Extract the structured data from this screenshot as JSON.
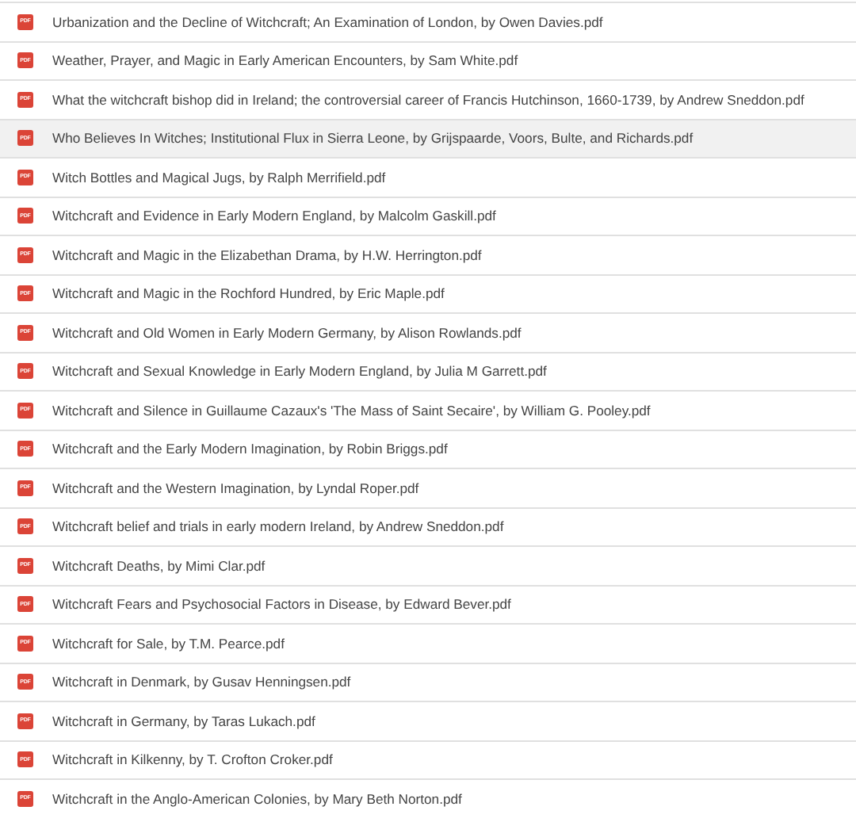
{
  "files": [
    {
      "name": "Urbanization and the Decline of Witchcraft; An Examination of London, by Owen Davies.pdf",
      "badge": "PDF",
      "selected": false
    },
    {
      "name": "Weather, Prayer, and Magic in Early American Encounters, by Sam White.pdf",
      "badge": "PDF",
      "selected": false
    },
    {
      "name": "What the witchcraft bishop did in Ireland; the controversial career of Francis Hutchinson, 1660-1739, by Andrew Sneddon.pdf",
      "badge": "PDF",
      "selected": false
    },
    {
      "name": "Who Believes In Witches; Institutional Flux in Sierra Leone, by Grijspaarde, Voors, Bulte, and Richards.pdf",
      "badge": "PDF",
      "selected": true
    },
    {
      "name": "Witch Bottles and Magical Jugs, by Ralph Merrifield.pdf",
      "badge": "PDF",
      "selected": false
    },
    {
      "name": "Witchcraft and Evidence in Early Modern England, by Malcolm Gaskill.pdf",
      "badge": "PDF",
      "selected": false
    },
    {
      "name": "Witchcraft and Magic in the Elizabethan Drama, by H.W. Herrington.pdf",
      "badge": "PDF",
      "selected": false
    },
    {
      "name": "Witchcraft and Magic in the Rochford Hundred, by Eric Maple.pdf",
      "badge": "PDF",
      "selected": false
    },
    {
      "name": "Witchcraft and Old Women in Early Modern Germany, by Alison Rowlands.pdf",
      "badge": "PDF",
      "selected": false
    },
    {
      "name": "Witchcraft and Sexual Knowledge in Early Modern England, by Julia M Garrett.pdf",
      "badge": "PDF",
      "selected": false
    },
    {
      "name": "Witchcraft and Silence in Guillaume Cazaux's 'The Mass of Saint Secaire', by William G. Pooley.pdf",
      "badge": "PDF",
      "selected": false
    },
    {
      "name": "Witchcraft and the Early Modern Imagination, by Robin Briggs.pdf",
      "badge": "PDF",
      "selected": false
    },
    {
      "name": "Witchcraft and the Western Imagination, by Lyndal Roper.pdf",
      "badge": "PDF",
      "selected": false
    },
    {
      "name": "Witchcraft belief and trials in early modern Ireland, by Andrew Sneddon.pdf",
      "badge": "PDF",
      "selected": false
    },
    {
      "name": "Witchcraft Deaths, by Mimi Clar.pdf",
      "badge": "PDF",
      "selected": false
    },
    {
      "name": "Witchcraft Fears and Psychosocial Factors in Disease, by Edward Bever.pdf",
      "badge": "PDF",
      "selected": false
    },
    {
      "name": "Witchcraft for Sale, by T.M. Pearce.pdf",
      "badge": "PDF",
      "selected": false
    },
    {
      "name": "Witchcraft in Denmark, by Gusav Henningsen.pdf",
      "badge": "PDF",
      "selected": false
    },
    {
      "name": "Witchcraft in Germany, by Taras Lukach.pdf",
      "badge": "PDF",
      "selected": false
    },
    {
      "name": "Witchcraft in Kilkenny, by T. Crofton Croker.pdf",
      "badge": "PDF",
      "selected": false
    },
    {
      "name": "Witchcraft in the Anglo-American Colonies, by Mary Beth Norton.pdf",
      "badge": "PDF",
      "selected": false
    }
  ]
}
